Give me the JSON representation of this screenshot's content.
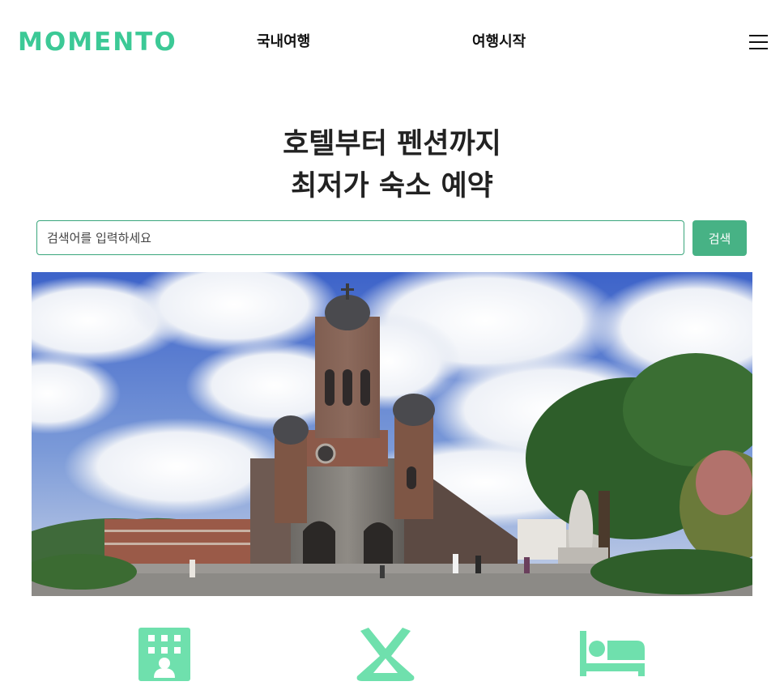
{
  "header": {
    "logo": "MOMENTO",
    "nav": [
      {
        "label": "국내여행"
      },
      {
        "label": "여행시작"
      }
    ],
    "menu_icon": "hamburger-menu-icon"
  },
  "hero": {
    "title_line1": "호텔부터 펜션까지",
    "title_line2": "최저가 숙소 예약"
  },
  "search": {
    "placeholder": "검색어를 입력하세요",
    "value": "",
    "button_label": "검색"
  },
  "banner": {
    "image_subject": "brick cathedral with twin domed towers under a cloudy blue sky, statue and tree on the right"
  },
  "categories": [
    {
      "icon": "hotel-building-icon"
    },
    {
      "icon": "camping-tent-icon"
    },
    {
      "icon": "bed-icon"
    }
  ],
  "colors": {
    "brand": "#3cc996",
    "button": "#47b285",
    "icon": "#6fe0ad"
  }
}
